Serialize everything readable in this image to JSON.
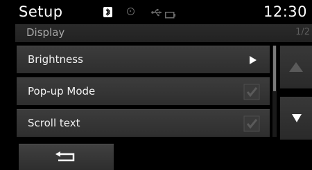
{
  "status": {
    "title": "Setup",
    "clock": "12:30",
    "icons": [
      "bluetooth-icon",
      "media-icon",
      "usb-icon",
      "battery-icon"
    ]
  },
  "subheader": {
    "title": "Display",
    "page": "1/2"
  },
  "list": {
    "items": [
      {
        "label": "Brightness",
        "control": "arrow-right-icon"
      },
      {
        "label": "Pop-up Mode",
        "control": "checkbox",
        "checked": true
      },
      {
        "label": "Scroll text",
        "control": "checkbox",
        "checked": true
      }
    ]
  },
  "scroll": {
    "up_icon": "triangle-up-icon",
    "down_icon": "triangle-down-icon",
    "up_enabled": false,
    "down_enabled": true
  },
  "footer": {
    "back_icon": "return-arrow-icon"
  },
  "colors": {
    "background": "#000000",
    "row": "#343434",
    "text": "#ffffff",
    "muted": "#a8a8a8"
  }
}
